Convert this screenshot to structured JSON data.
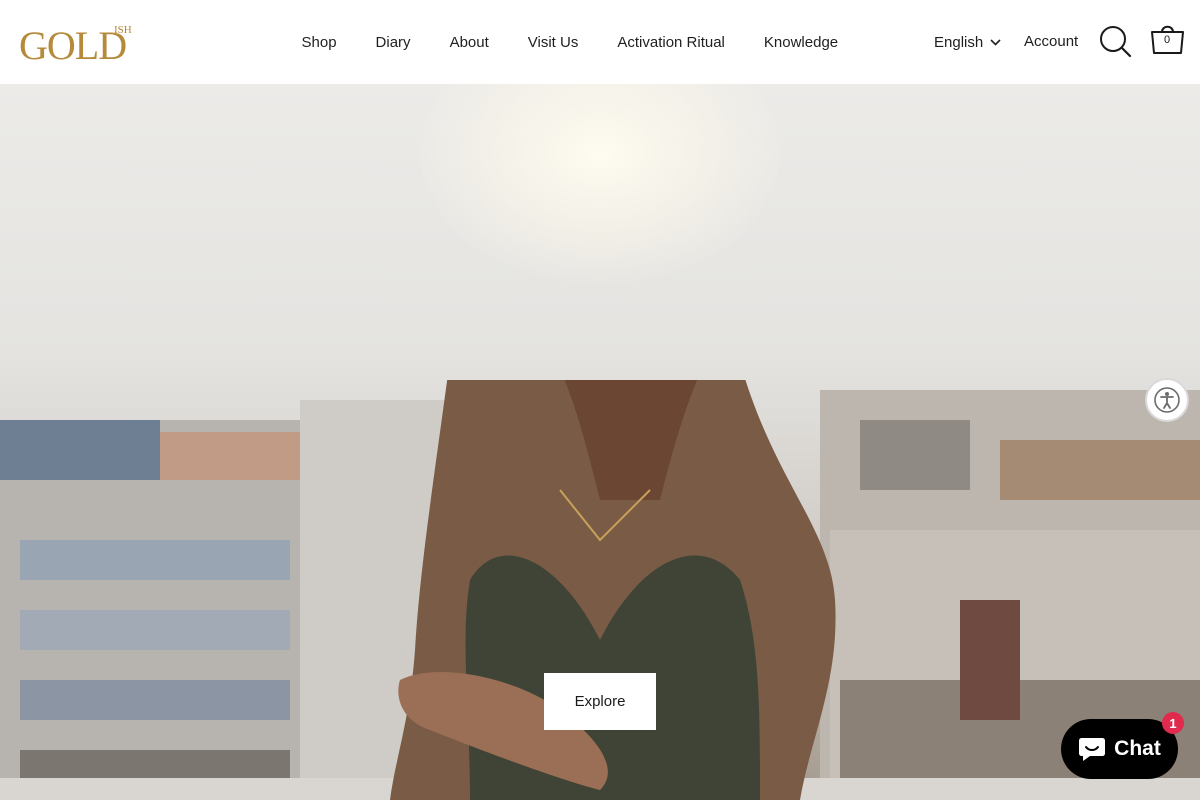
{
  "brand": {
    "logo_text": "GOLD",
    "logo_sup": "ISH",
    "colors": {
      "gold": "#b58a3a",
      "chat_badge": "#e02a4e"
    }
  },
  "nav": {
    "items": [
      {
        "label": "Shop"
      },
      {
        "label": "Diary"
      },
      {
        "label": "About"
      },
      {
        "label": "Visit Us"
      },
      {
        "label": "Activation Ritual"
      },
      {
        "label": "Knowledge"
      }
    ]
  },
  "header": {
    "language": "English",
    "language_icon": "chevron-down-icon",
    "account_label": "Account",
    "search_icon": "search-icon",
    "cart_icon": "cart-icon",
    "cart_count": "0"
  },
  "hero": {
    "cta_label": "Explore"
  },
  "accessibility": {
    "icon": "accessibility-icon"
  },
  "chat": {
    "label": "Chat",
    "badge_count": "1",
    "icon": "chat-bubble-icon"
  }
}
